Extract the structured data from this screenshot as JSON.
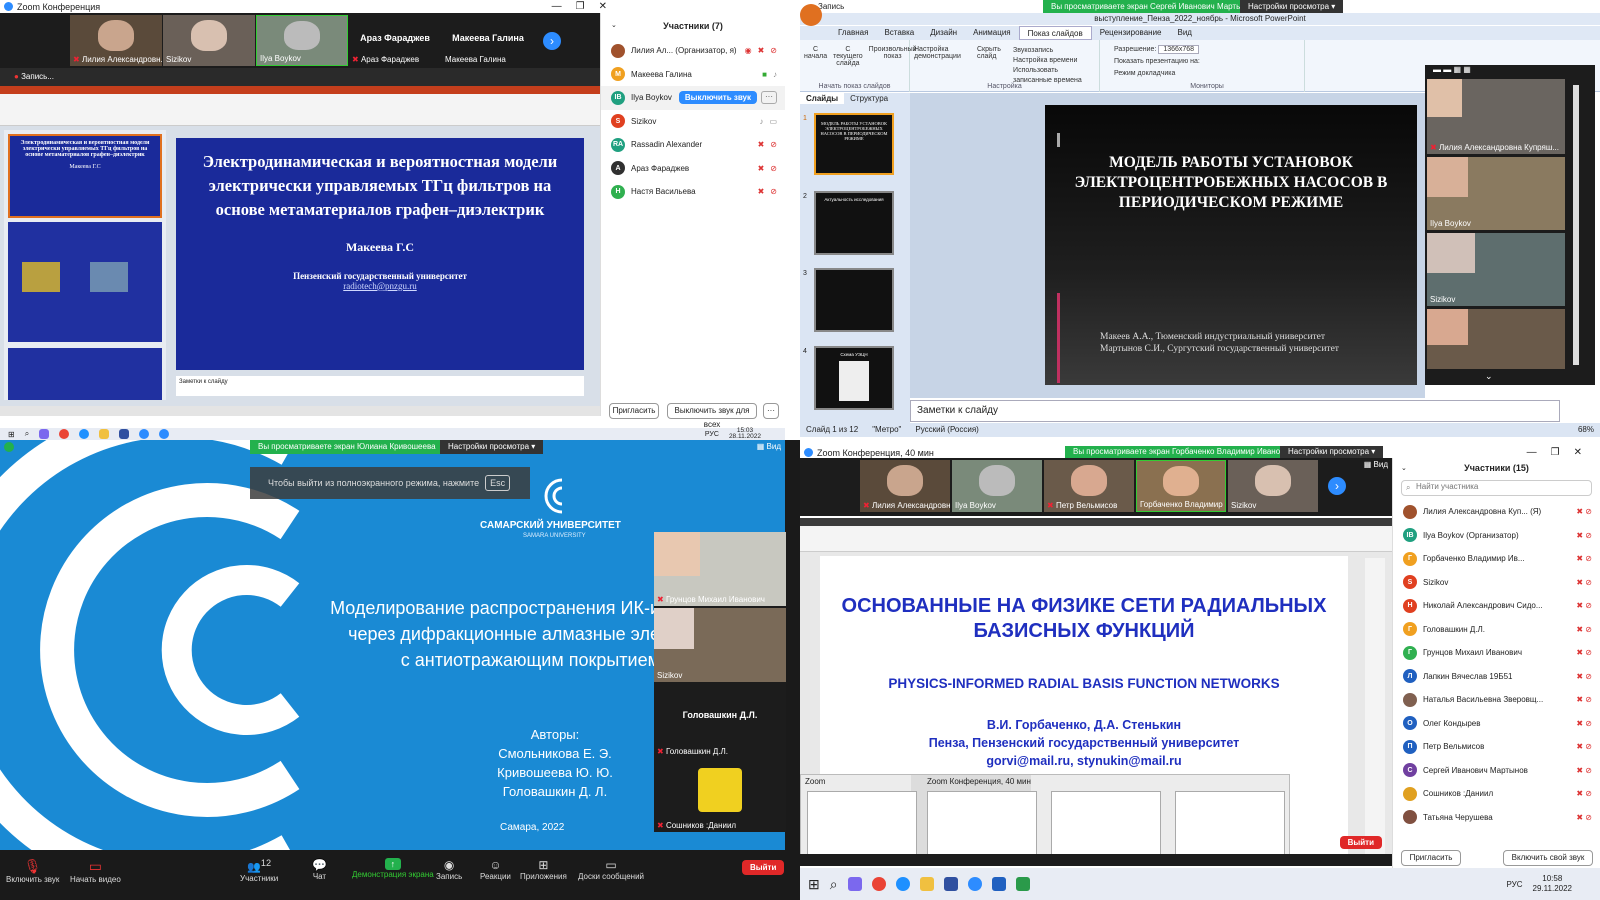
{
  "q1": {
    "window_title": "Zoom Конференция",
    "recording": "Запись...",
    "tiles": [
      {
        "name": "Лилия Александровн..."
      },
      {
        "name": "Sizikov"
      },
      {
        "name": "Ilya Boykov"
      },
      {
        "name": "Араз Фараджев",
        "big": "Араз Фараджев"
      },
      {
        "name": "Макеева Галина",
        "big": "Макеева Галина"
      }
    ],
    "slide": {
      "title": "Электродинамическая и вероятностная модели электрически управляемых ТГц фильтров на основе метаматериалов графен–диэлектрик",
      "author": "Макеева Г.С",
      "org": "Пензенский государственный университет",
      "email": "radiotech@pnzgu.ru"
    },
    "thumb_title": "Электродинамическая и вероятностная модели электрически управляемых ТГц фильтров на основе метаматериалов графен–диэлектрик",
    "thumb_author": "Макеева Г.С",
    "notes_hint": "Заметки к слайду",
    "participants": {
      "header": "Участники (7)",
      "list": [
        {
          "name": "Лилия Ал...  (Организатор, я)",
          "initial": "",
          "color": "#a0522d"
        },
        {
          "name": "Макеева Галина",
          "initial": "М",
          "color": "#f0a020"
        },
        {
          "name": "Ilya Boykov",
          "initial": "IB",
          "color": "#20a080"
        },
        {
          "name": "Sizikov",
          "initial": "S",
          "color": "#e04020"
        },
        {
          "name": "Rassadin Alexander",
          "initial": "RA",
          "color": "#20a080"
        },
        {
          "name": "Араз Фараджев",
          "initial": "А",
          "color": "#303030"
        },
        {
          "name": "Настя Васильева",
          "initial": "Н",
          "color": "#30b050"
        }
      ],
      "unmute_button": "Выключить звук",
      "invite": "Пригласить",
      "mute_all": "Выключить звук для всех"
    },
    "taskbar": {
      "time": "15:03",
      "date": "28.11.2022",
      "lang": "РУС"
    }
  },
  "q2": {
    "banner": "Вы просматриваете экран Сергей Иванович Мартынов",
    "view_settings": "Настройки просмотра",
    "zoom_label": "Запись",
    "ppt_title": "выступление_Пенза_2022_ноябрь - Microsoft PowerPoint",
    "tabs": [
      "Главная",
      "Вставка",
      "Дизайн",
      "Анимация",
      "Показ слайдов",
      "Рецензирование",
      "Вид"
    ],
    "groups": [
      {
        "label": "Начать показ слайдов",
        "items": [
          "С начала",
          "С текущего слайда",
          "Произвольный показ"
        ]
      },
      {
        "label": "Настройка",
        "items": [
          "Настройка демонстрации",
          "Скрыть слайд",
          "Звукозапись",
          "Настройка времени",
          "Использовать записанные времена"
        ]
      },
      {
        "label": "Мониторы",
        "items": [
          "Разрешение:",
          "1366x768",
          "Показать презентацию на:",
          "Режим докладчика"
        ]
      }
    ],
    "pane_tabs": [
      "Слайды",
      "Структура"
    ],
    "slide": {
      "title": "МОДЕЛЬ РАБОТЫ УСТАНОВОК ЭЛЕКТРОЦЕНТРОБЕЖНЫХ НАСОСОВ В ПЕРИОДИЧЕСКОМ РЕЖИМЕ",
      "author1": "Макеев А.А., Тюменский индустриальный университет",
      "author2": "Мартынов С.И., Сургутский государственный университет"
    },
    "thumb1": "МОДЕЛЬ РАБОТЫ УСТАНОВОК ЭЛЕКТРОЦЕНТРОБЕЖНЫХ НАСОСОВ В ПЕРИОДИЧЕСКОМ РЕЖИМЕ",
    "thumb2": "Актуальность исследования",
    "thumb4": "Схема УЭЦН",
    "notes": "Заметки к слайду",
    "status": {
      "slide": "Слайд 1 из 12",
      "theme": "\"Метро\"",
      "lang": "Русский (Россия)",
      "zoom": "68%"
    },
    "videos": [
      {
        "name": "Лилия Александровна Купряш..."
      },
      {
        "name": "Ilya Boykov"
      },
      {
        "name": "Sizikov"
      },
      {
        "name": ""
      }
    ]
  },
  "q3": {
    "banner": "Вы просматриваете экран Юлиана Кривошеева",
    "view_settings": "Настройки просмотра",
    "view_label": "Вид",
    "esc_hint": "Чтобы выйти из полноэкранного режима, нажмите",
    "esc_key": "Esc",
    "uni_name": "САМАРСКИЙ УНИВЕРСИТЕТ",
    "uni_sub": "SAMARA UNIVERSITY",
    "slide": {
      "line1": "Моделирование распространения ИК-и",
      "line2": "через дифракционные алмазные эле",
      "line3": "с антиотражающим покрытием",
      "authors_label": "Авторы:",
      "a1": "Смольникова Е. Э.",
      "a2": "Кривошеева Ю. Ю.",
      "a3": "Головашкин Д. Л.",
      "place": "Самара, 2022"
    },
    "videos": [
      {
        "name": "Грунцов Михаил Иванович"
      },
      {
        "name": "Sizikov"
      },
      {
        "name": "Головашкин Д.Л.",
        "big": "Головашкин Д.Л."
      },
      {
        "name": "Сошников :Даниил"
      }
    ],
    "toolbar": [
      {
        "label": "Включить звук"
      },
      {
        "label": "Начать видео"
      },
      {
        "label": "Участники",
        "count": "12"
      },
      {
        "label": "Чат"
      },
      {
        "label": "Демонстрация экрана"
      },
      {
        "label": "Запись"
      },
      {
        "label": "Реакции"
      },
      {
        "label": "Приложения"
      },
      {
        "label": "Доски сообщений"
      }
    ],
    "leave": "Выйти"
  },
  "q4": {
    "window_title": "Zoom Конференция, 40 мин",
    "banner": "Вы просматриваете экран Горбаченко Владимир Иванович",
    "view_settings": "Настройки просмотра",
    "view_label": "Вид",
    "tiles": [
      {
        "name": "Лилия Александровн..."
      },
      {
        "name": "Ilya Boykov"
      },
      {
        "name": "Петр Вельмисов"
      },
      {
        "name": "Горбаченко Владимир ..."
      },
      {
        "name": "Sizikov"
      }
    ],
    "slide": {
      "title": "ОСНОВАННЫЕ НА ФИЗИКЕ СЕТИ РАДИАЛЬНЫХ БАЗИСНЫХ ФУНКЦИЙ",
      "subtitle": "PHYSICS-INFORMED RADIAL BASIS FUNCTION NETWORKS",
      "authors": "В.И. Горбаченко, Д.А. Стенькин",
      "place": "Пенза, Пензенский государственный университет",
      "emails": "gorvi@mail.ru, stynukin@mail.ru"
    },
    "popup": [
      {
        "title": "Zoom"
      },
      {
        "title": "Zoom Конференция, 40 мин"
      }
    ],
    "participants": {
      "header": "Участники (15)",
      "search_placeholder": "Найти участника",
      "list": [
        {
          "name": "Лилия Александровна Куп... (Я)",
          "initial": "",
          "color": "#a0522d"
        },
        {
          "name": "Ilya Boykov (Организатор)",
          "initial": "IB",
          "color": "#20a080"
        },
        {
          "name": "Горбаченко Владимир Ив...",
          "initial": "Г",
          "color": "#f0a020"
        },
        {
          "name": "Sizikov",
          "initial": "S",
          "color": "#e04020"
        },
        {
          "name": "Николай Александрович Сидо...",
          "initial": "Н",
          "color": "#e04020"
        },
        {
          "name": "Головашкин Д.Л.",
          "initial": "Г",
          "color": "#f0a020"
        },
        {
          "name": "Грунцов Михаил Иванович",
          "initial": "Г",
          "color": "#30b050"
        },
        {
          "name": "Лапкин Вячеслав 19Б51",
          "initial": "Л",
          "color": "#2060c0"
        },
        {
          "name": "Наталья Васильевна Зверовщ...",
          "initial": "",
          "color": "#806050"
        },
        {
          "name": "Олег Кондырев",
          "initial": "О",
          "color": "#2060c0"
        },
        {
          "name": "Петр Вельмисов",
          "initial": "П",
          "color": "#2060c0"
        },
        {
          "name": "Сергей Иванович Мартынов",
          "initial": "С",
          "color": "#7040a0"
        },
        {
          "name": "Сошников :Даниил",
          "initial": "",
          "color": "#e0a020"
        },
        {
          "name": "Татьяна Черушева",
          "initial": "",
          "color": "#805040"
        }
      ],
      "invite": "Пригласить",
      "unmute_self": "Включить свой звук"
    },
    "leave": "Выйти",
    "taskbar": {
      "time": "10:58",
      "date": "29.11.2022",
      "lang": "РУС"
    }
  },
  "colors": {
    "zoom_blue": "#2d8cff",
    "banner_green": "#23b14d",
    "slide_blue": "#1a2a9a",
    "leave_red": "#e02828"
  }
}
